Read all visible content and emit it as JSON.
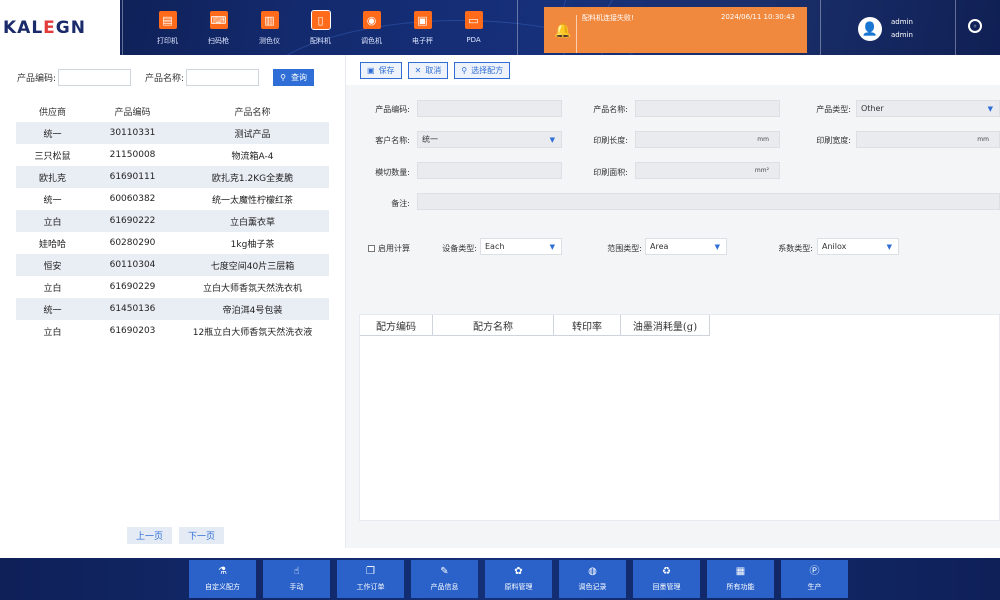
{
  "brand": {
    "logo_a": "KAL",
    "logo_e": "E",
    "logo_b": "GN"
  },
  "nav": [
    {
      "label": "打印机",
      "icon": "printer-icon",
      "glyph": "▤"
    },
    {
      "label": "扫码枪",
      "icon": "barcode-scanner-icon",
      "glyph": "⌨"
    },
    {
      "label": "测色仪",
      "icon": "colorimeter-icon",
      "glyph": "▥"
    },
    {
      "label": "配料机",
      "icon": "dispenser-icon",
      "glyph": "▯"
    },
    {
      "label": "调色机",
      "icon": "color-mixer-icon",
      "glyph": "◉"
    },
    {
      "label": "电子秤",
      "icon": "scale-icon",
      "glyph": "▣"
    },
    {
      "label": "PDA",
      "icon": "pda-icon",
      "glyph": "▭"
    }
  ],
  "alert": {
    "message": "配料机连接失败!",
    "time": "2024/06/11 10:30:43"
  },
  "user": {
    "name": "admin",
    "role": "admin"
  },
  "search": {
    "code_label": "产品编码:",
    "name_label": "产品名称:",
    "code_value": "",
    "name_value": "",
    "button": "查询"
  },
  "products": {
    "headers": [
      "供应商",
      "产品编码",
      "产品名称"
    ],
    "rows": [
      [
        "统一",
        "30110331",
        "测试产品"
      ],
      [
        "三只松鼠",
        "21150008",
        "物流箱A-4"
      ],
      [
        "欧扎克",
        "61690111",
        "欧扎克1.2KG全麦脆"
      ],
      [
        "统一",
        "60060382",
        "统一太魔性柠檬红茶"
      ],
      [
        "立白",
        "61690222",
        "立白薰衣草"
      ],
      [
        "娃哈哈",
        "60280290",
        "1kg柚子茶"
      ],
      [
        "恒安",
        "60110304",
        "七度空间40片三层箱"
      ],
      [
        "立白",
        "61690229",
        "立白大师香氛天然洗衣机"
      ],
      [
        "统一",
        "61450136",
        "帝泊洱4号包装"
      ],
      [
        "立白",
        "61690203",
        "12瓶立白大师香氛天然洗衣液"
      ]
    ]
  },
  "pager": {
    "prev": "上一页",
    "next": "下一页"
  },
  "toolbar": {
    "save": "保存",
    "cancel": "取消",
    "select": "选择配方"
  },
  "form": {
    "product_code_label": "产品编码:",
    "product_code_value": "",
    "product_name_label": "产品名称:",
    "product_name_value": "",
    "product_type_label": "产品类型:",
    "product_type_value": "Other",
    "customer_label": "客户名称:",
    "customer_value": "统一",
    "print_length_label": "印刷长度:",
    "print_length_unit": "mm",
    "print_width_label": "印刷宽度:",
    "print_width_unit": "mm",
    "die_qty_label": "模切数量:",
    "die_qty_value": "",
    "print_area_label": "印刷面积:",
    "print_area_unit": "mm²",
    "remark_label": "备注:",
    "remark_value": ""
  },
  "options": {
    "enable_calc": "启用计算",
    "device_type_label": "设备类型:",
    "device_type_value": "Each",
    "range_type_label": "范围类型:",
    "range_type_value": "Area",
    "coef_type_label": "系数类型:",
    "coef_type_value": "Anilox"
  },
  "formula_grid": {
    "headers": [
      "配方编码",
      "配方名称",
      "转印率",
      "油墨消耗量(g)"
    ]
  },
  "bottom_nav": [
    {
      "label": "自定义配方",
      "glyph": "⚗"
    },
    {
      "label": "手动",
      "glyph": "☝"
    },
    {
      "label": "工作订单",
      "glyph": "❐"
    },
    {
      "label": "产品信息",
      "glyph": "✎"
    },
    {
      "label": "原料管理",
      "glyph": "✿"
    },
    {
      "label": "调色记录",
      "glyph": "◍"
    },
    {
      "label": "回墨管理",
      "glyph": "♻"
    },
    {
      "label": "所有功能",
      "glyph": "▦"
    },
    {
      "label": "生产",
      "glyph": "Ⓟ"
    }
  ]
}
